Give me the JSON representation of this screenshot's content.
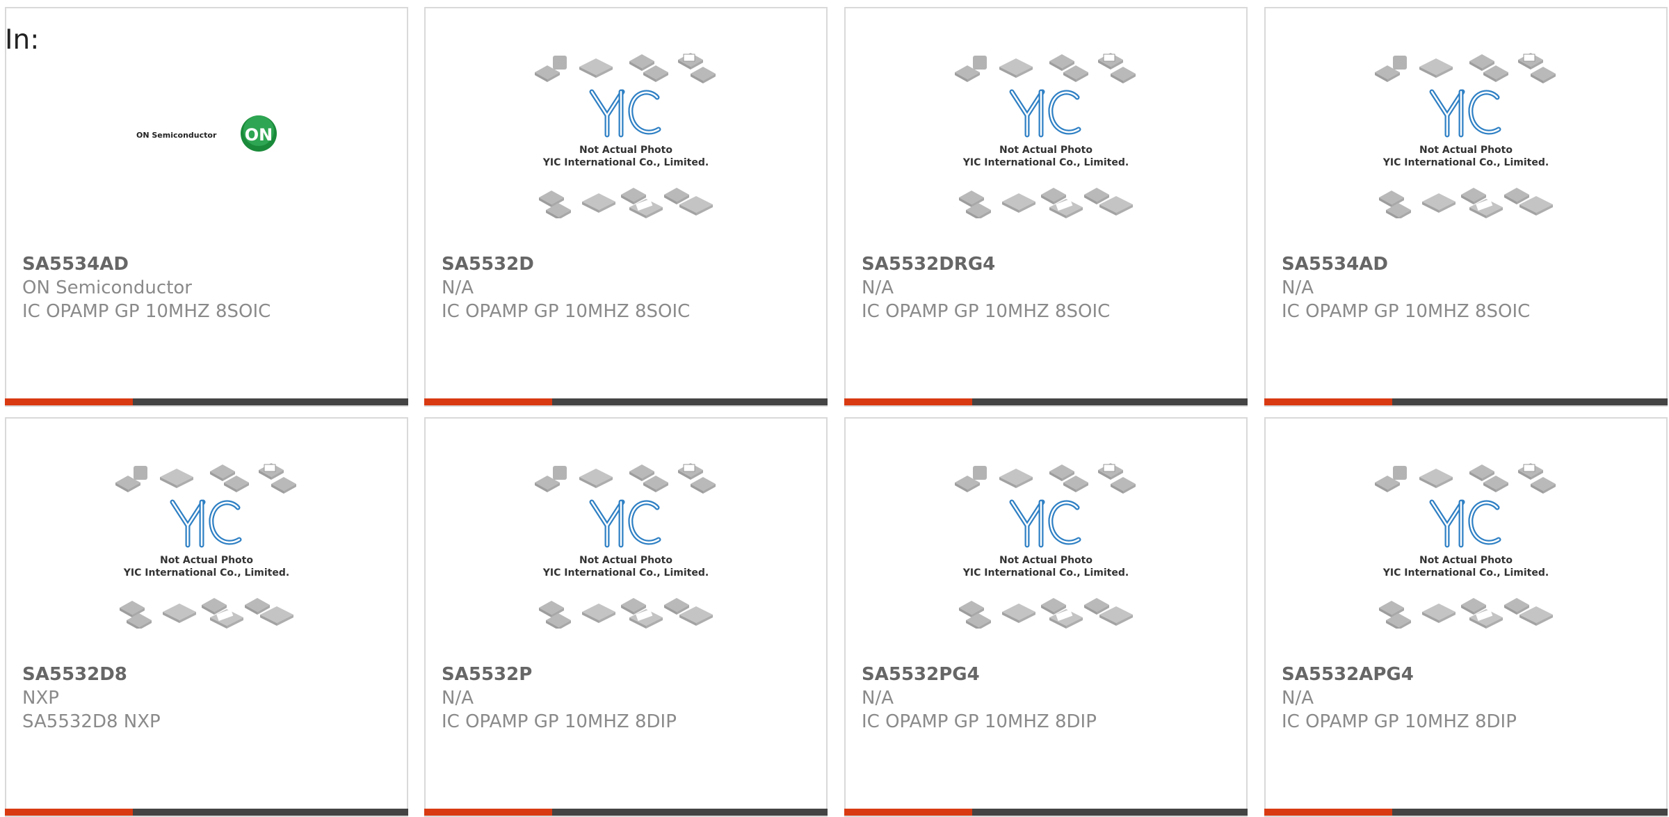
{
  "header": {
    "in_label": "In:"
  },
  "placeholder": {
    "line1": "Not Actual Photo",
    "line2": "YIC International Co., Limited."
  },
  "on_logo": {
    "text": "ON Semiconductor",
    "badge": "ON"
  },
  "colors": {
    "accent_bar": "#d93a12",
    "dark_bar": "#444444",
    "on_green": "#1a8a3a",
    "yic_blue": "#2f80c4"
  },
  "products": [
    {
      "part": "SA5534AD",
      "maker": "ON Semiconductor",
      "desc": "IC OPAMP GP 10MHZ 8SOIC",
      "image": "on-semiconductor-logo"
    },
    {
      "part": "SA5532D",
      "maker": "N/A",
      "desc": "IC OPAMP GP 10MHZ 8SOIC",
      "image": "yic-placeholder"
    },
    {
      "part": "SA5532DRG4",
      "maker": "N/A",
      "desc": "IC OPAMP GP 10MHZ 8SOIC",
      "image": "yic-placeholder"
    },
    {
      "part": "SA5534AD",
      "maker": "N/A",
      "desc": "IC OPAMP GP 10MHZ 8SOIC",
      "image": "yic-placeholder"
    },
    {
      "part": "SA5532D8",
      "maker": "NXP",
      "desc": "SA5532D8 NXP",
      "image": "yic-placeholder"
    },
    {
      "part": "SA5532P",
      "maker": "N/A",
      "desc": "IC OPAMP GP 10MHZ 8DIP",
      "image": "yic-placeholder"
    },
    {
      "part": "SA5532PG4",
      "maker": "N/A",
      "desc": "IC OPAMP GP 10MHZ 8DIP",
      "image": "yic-placeholder"
    },
    {
      "part": "SA5532APG4",
      "maker": "N/A",
      "desc": "IC OPAMP GP 10MHZ 8DIP",
      "image": "yic-placeholder"
    }
  ]
}
